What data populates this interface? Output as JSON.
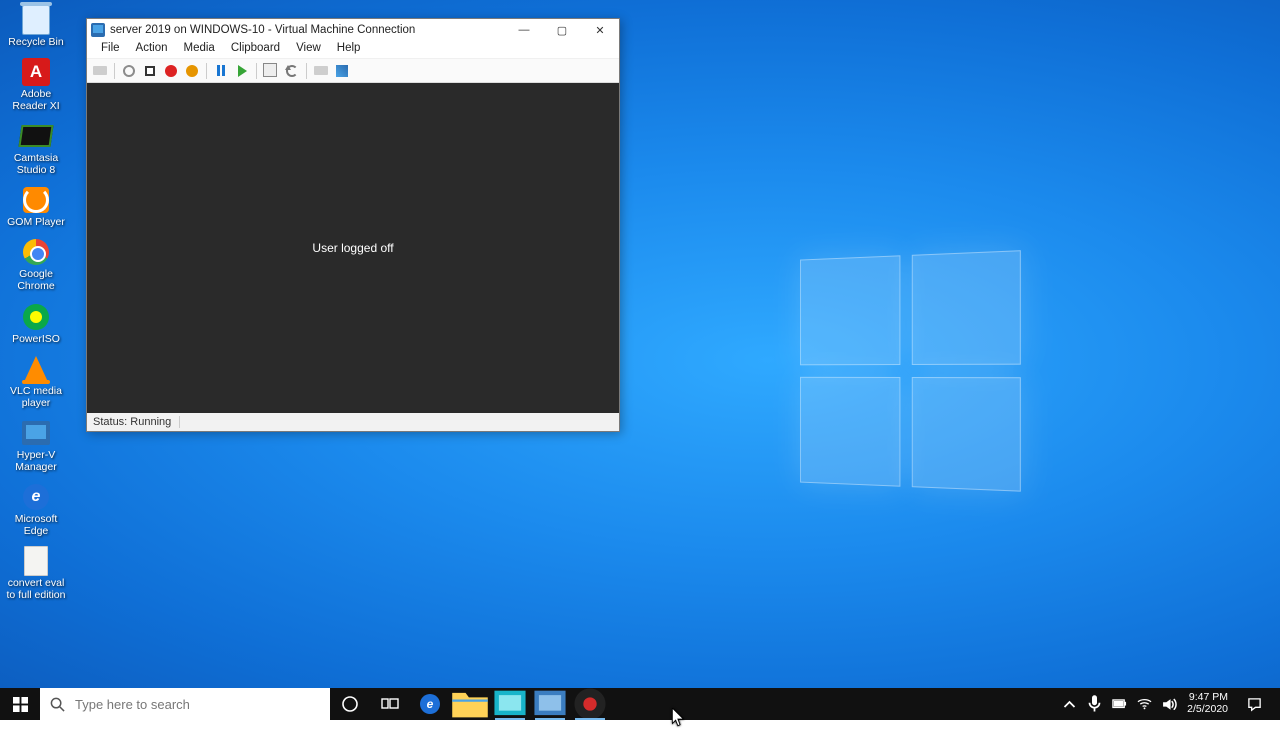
{
  "desktop_icons": [
    {
      "label": "Recycle Bin",
      "icon": "bin"
    },
    {
      "label": "Adobe\nReader XI",
      "icon": "acro"
    },
    {
      "label": "Camtasia\nStudio 8",
      "icon": "camt"
    },
    {
      "label": "GOM Player",
      "icon": "gom"
    },
    {
      "label": "Google\nChrome",
      "icon": "chrome"
    },
    {
      "label": "PowerISO",
      "icon": "piso"
    },
    {
      "label": "VLC media\nplayer",
      "icon": "vlc"
    },
    {
      "label": "Hyper-V\nManager",
      "icon": "hv"
    },
    {
      "label": "Microsoft\nEdge",
      "icon": "edge"
    },
    {
      "label": "convert eval\nto full edition",
      "icon": "txt"
    }
  ],
  "vmc": {
    "title": "server 2019 on WINDOWS-10 - Virtual Machine Connection",
    "menu": [
      "File",
      "Action",
      "Media",
      "Clipboard",
      "View",
      "Help"
    ],
    "content_message": "User logged off",
    "status": "Status: Running"
  },
  "taskbar": {
    "search_placeholder": "Type here to search",
    "apps": [
      {
        "name": "edge",
        "color": "#1d6fd8"
      },
      {
        "name": "file-explorer",
        "color": "#ffd257"
      },
      {
        "name": "hyperv-manager",
        "color": "#18b4c9"
      },
      {
        "name": "vmc",
        "color": "#3b7dc0"
      },
      {
        "name": "snagit",
        "color": "#d52b2b"
      }
    ]
  },
  "tray": {
    "time": "9:47 PM",
    "date": "2/5/2020"
  }
}
